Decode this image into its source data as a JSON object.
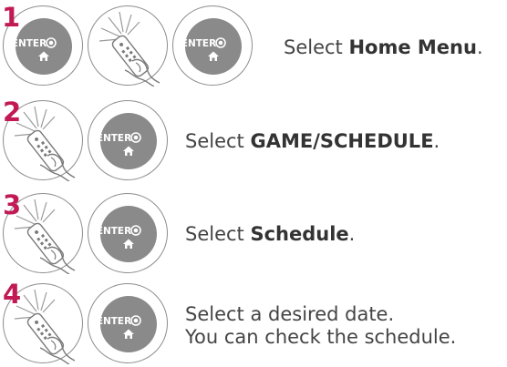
{
  "colors": {
    "step_number": "#c21a55",
    "text": "#444444",
    "button": "#8a8a8a",
    "outline": "#8d8d8d"
  },
  "button": {
    "label": "ENTER",
    "icons": [
      "ok-dot-icon",
      "home-icon"
    ]
  },
  "steps": [
    {
      "number": "1",
      "prefix": "Select ",
      "bold": "Home Menu",
      "suffix": ".",
      "line2": ""
    },
    {
      "number": "2",
      "prefix": "Select ",
      "bold": "GAME/SCHEDULE",
      "suffix": ".",
      "line2": ""
    },
    {
      "number": "3",
      "prefix": "Select ",
      "bold": "Schedule",
      "suffix": ".",
      "line2": ""
    },
    {
      "number": "4",
      "prefix": "Select a desired date.",
      "bold": "",
      "suffix": "",
      "line2": "You can check the schedule."
    }
  ]
}
